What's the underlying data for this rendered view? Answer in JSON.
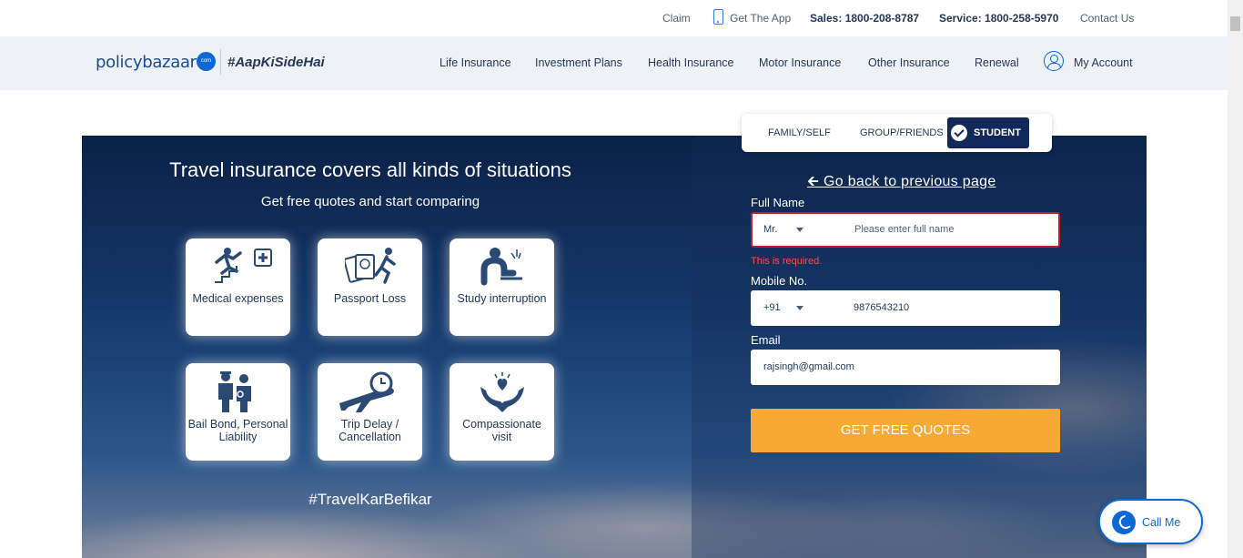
{
  "topbar": {
    "claim": "Claim",
    "get_app": "Get The App",
    "sales": "Sales: 1800-208-8787",
    "service": "Service: 1800-258-5970",
    "contact": "Contact Us"
  },
  "nav": {
    "logo_text_1": "policy",
    "logo_text_2": "bazaar",
    "logo_dot": "com",
    "hashtag": "#AapKiSideHai",
    "links": [
      "Life Insurance",
      "Investment Plans",
      "Health Insurance",
      "Motor Insurance",
      "Other Insurance",
      "Renewal"
    ],
    "account": "My Account"
  },
  "hero": {
    "title": "Travel insurance covers all kinds of situations",
    "subtitle": "Get free quotes and start comparing",
    "cards": [
      {
        "label": "Medical expenses",
        "icon": "medical-icon"
      },
      {
        "label": "Passport Loss",
        "icon": "passport-icon"
      },
      {
        "label": "Study interruption",
        "icon": "study-icon"
      },
      {
        "label": "Bail Bond, Personal Liability",
        "icon": "police-icon"
      },
      {
        "label": "Trip Delay / Cancellation",
        "icon": "plane-clock-icon"
      },
      {
        "label": "Compassionate visit",
        "icon": "heart-hands-icon"
      }
    ],
    "tagline": "#TravelKarBefikar"
  },
  "form": {
    "tabs": [
      "FAMILY/SELF",
      "GROUP/FRIENDS",
      "STUDENT"
    ],
    "active_tab": "STUDENT",
    "go_back": "Go back to previous page",
    "full_name_label": "Full Name",
    "title_value": "Mr.",
    "full_name_placeholder": "Please enter full name",
    "error": "This is required.",
    "mobile_label": "Mobile No.",
    "country_code": "+91",
    "mobile_value": "9876543210",
    "email_label": "Email",
    "email_value": "rajsingh@gmail.com",
    "cta": "GET FREE QUOTES"
  },
  "call_me": "Call Me",
  "colors": {
    "accent": "#0d68d6",
    "cta": "#f7a936",
    "error": "#c0202c",
    "navy": "#13285a"
  }
}
